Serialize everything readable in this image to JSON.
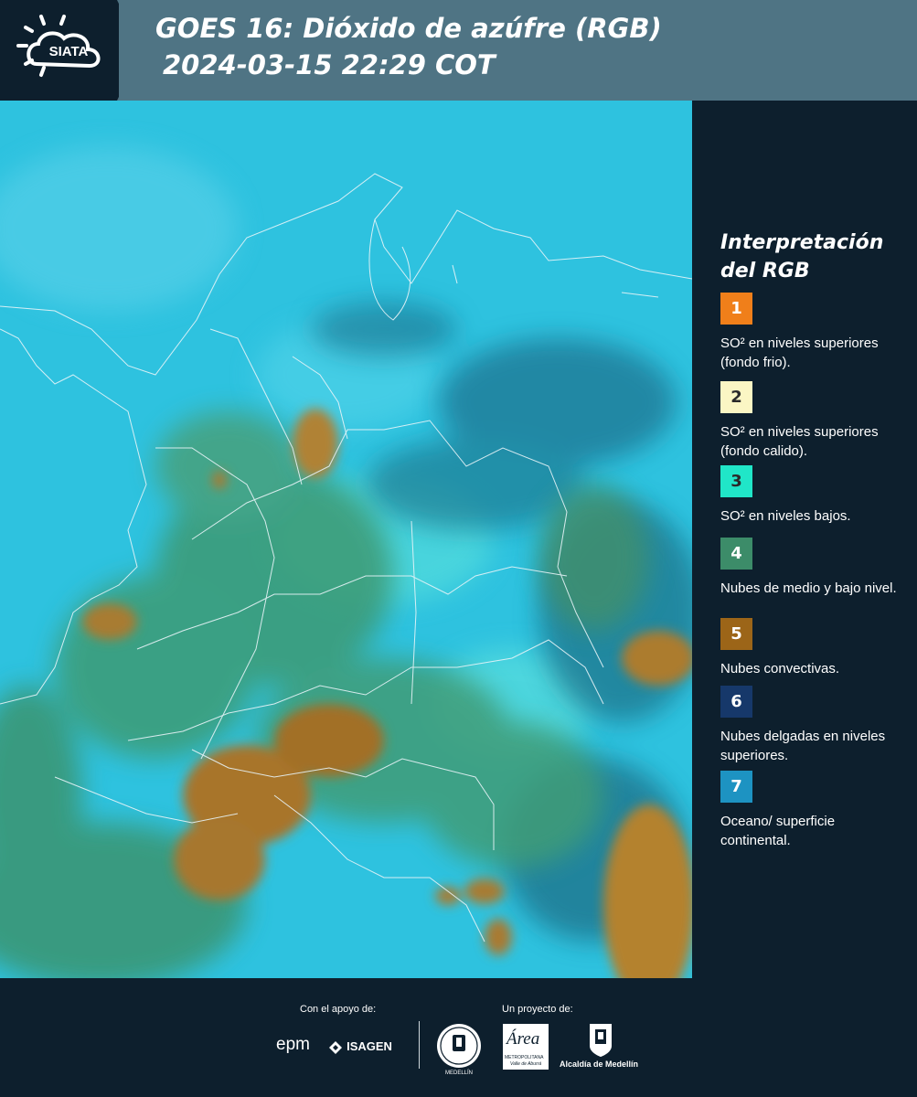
{
  "header": {
    "logo_text": "SIATA",
    "title_line1": "GOES 16: Dióxido de azúfre (RGB)",
    "title_line2": "2024-03-15 22:29 COT"
  },
  "legend": {
    "title": "Interpretación del RGB",
    "items": [
      {
        "number": "1",
        "color": "#f07f1a",
        "number_color": "#ffffff",
        "text": "SO² en niveles superiores (fondo frio)."
      },
      {
        "number": "2",
        "color": "#fbf6c4",
        "number_color": "#2a2a2a",
        "text": "SO² en niveles superiores (fondo calido)."
      },
      {
        "number": "3",
        "color": "#20e6c8",
        "number_color": "#2a2a2a",
        "text": "SO² en niveles bajos."
      },
      {
        "number": "4",
        "color": "#3c8c69",
        "number_color": "#ffffff",
        "text": "Nubes de medio y bajo nivel."
      },
      {
        "number": "5",
        "color": "#9c6518",
        "number_color": "#ffffff",
        "text": "Nubes convectivas."
      },
      {
        "number": "6",
        "color": "#16386a",
        "number_color": "#ffffff",
        "text": "Nubes delgadas en niveles superiores."
      },
      {
        "number": "7",
        "color": "#1d93c2",
        "number_color": "#ffffff",
        "text": "Oceano/ superficie continental."
      }
    ]
  },
  "footer": {
    "support_caption": "Con el apoyo de:",
    "project_caption": "Un proyecto de:",
    "epm_label": "epm",
    "isagen_label": "ISAGEN",
    "area_label": "Área",
    "area_sublabel": "METROPOLITANA",
    "area_subtitle": "Valle de Aburrá",
    "alcaldia_label": "Alcaldía de Medellín",
    "seal_label": "MEDELLÍN"
  }
}
